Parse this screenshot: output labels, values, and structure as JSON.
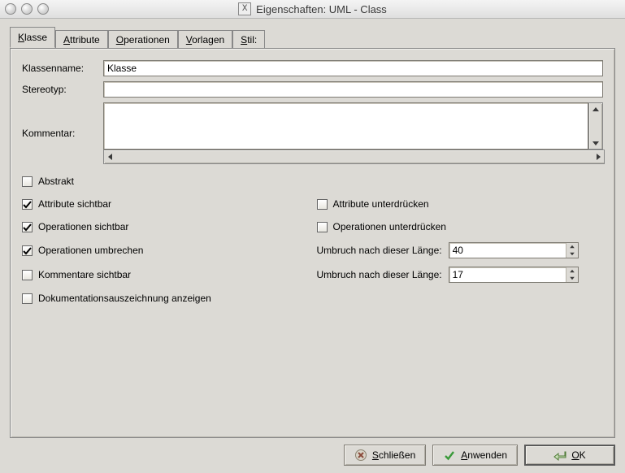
{
  "window": {
    "title": "Eigenschaften: UML - Class"
  },
  "tabs": [
    {
      "label": "Klasse",
      "accel": "K"
    },
    {
      "label": "Attribute",
      "accel": "A"
    },
    {
      "label": "Operationen",
      "accel": "O"
    },
    {
      "label": "Vorlagen",
      "accel": "V"
    },
    {
      "label": "Stil:",
      "accel": "S"
    }
  ],
  "active_tab_index": 0,
  "form": {
    "classname_label": "Klassenname:",
    "classname_value": "Klasse",
    "stereotype_label": "Stereotyp:",
    "stereotype_value": "",
    "comment_label": "Kommentar:",
    "comment_value": ""
  },
  "checks": {
    "abstract": {
      "label": "Abstrakt",
      "checked": false
    },
    "attrs_visible": {
      "label": "Attribute sichtbar",
      "checked": true
    },
    "attrs_suppress": {
      "label": "Attribute unterdrücken",
      "checked": false
    },
    "ops_visible": {
      "label": "Operationen sichtbar",
      "checked": true
    },
    "ops_suppress": {
      "label": "Operationen unterdrücken",
      "checked": false
    },
    "ops_wrap": {
      "label": "Operationen umbrechen",
      "checked": true
    },
    "comments_visible": {
      "label": "Kommentare sichtbar",
      "checked": false
    },
    "doc_markup": {
      "label": "Dokumentationsauszeichnung anzeigen",
      "checked": false
    }
  },
  "wrap": {
    "ops_len_label": "Umbruch nach dieser Länge:",
    "ops_len_value": "40",
    "cmt_len_label": "Umbruch nach dieser Länge:",
    "cmt_len_value": "17"
  },
  "buttons": {
    "close": {
      "text": "Schließen",
      "accel": "S",
      "icon": "close-x-icon"
    },
    "apply": {
      "text": "Anwenden",
      "accel": "A",
      "icon": "apply-check-icon"
    },
    "ok": {
      "text": "OK",
      "accel": "O",
      "icon": "ok-back-icon"
    }
  }
}
